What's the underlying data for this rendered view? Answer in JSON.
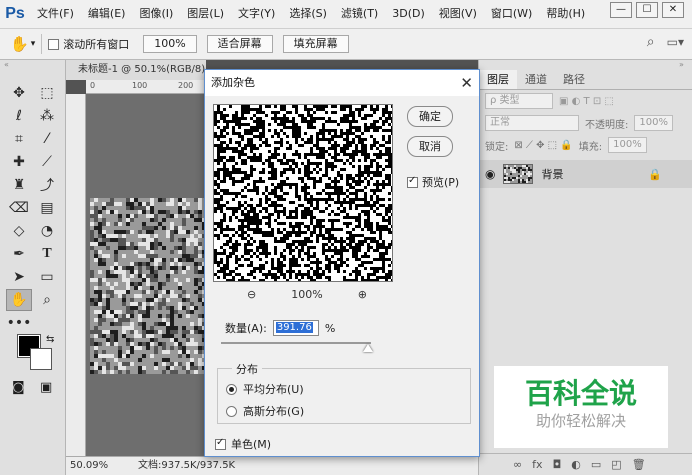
{
  "menubar": {
    "logo": "Ps",
    "items": [
      "文件(F)",
      "编辑(E)",
      "图像(I)",
      "图层(L)",
      "文字(Y)",
      "选择(S)",
      "滤镜(T)",
      "3D(D)",
      "视图(V)",
      "窗口(W)",
      "帮助(H)"
    ],
    "window_controls": [
      "—",
      "☐",
      "✕"
    ]
  },
  "options_bar": {
    "scroll_all_label": "滚动所有窗口",
    "zoom_value": "100%",
    "fit_screen": "适合屏幕",
    "fill_screen": "填充屏幕"
  },
  "document": {
    "tab_title": "未标题-1 @ 50.1%(RGB/8)",
    "ruler_ticks": [
      "0",
      "100",
      "200"
    ],
    "status_zoom": "50.09%",
    "status_info": "文档:937.5K/937.5K"
  },
  "layers_panel": {
    "tabs": [
      "图层",
      "通道",
      "路径"
    ],
    "filter_label": "ρ 类型",
    "blend_mode": "正常",
    "opacity_label": "不透明度:",
    "opacity_value": "100%",
    "lock_label": "锁定:",
    "fill_label": "填充:",
    "fill_value": "100%",
    "layer_name": "背景",
    "bottom_icons": [
      "∞",
      "fx",
      "◘",
      "◐",
      "▭",
      "◰",
      "🗑"
    ]
  },
  "dialog": {
    "title": "添加杂色",
    "ok_label": "确定",
    "cancel_label": "取消",
    "preview_label": "预览(P)",
    "preview_checked": true,
    "zoom_percent": "100%",
    "amount_label": "数量(A):",
    "amount_value": "391.76",
    "amount_unit": "%",
    "amount_fraction": 0.98,
    "distribution_legend": "分布",
    "uniform_label": "平均分布(U)",
    "gaussian_label": "高斯分布(G)",
    "selected_distribution": "uniform",
    "monochromatic_label": "单色(M)",
    "monochromatic_checked": true
  },
  "watermark": {
    "title": "百科全说",
    "subtitle": "助你轻松解决"
  }
}
